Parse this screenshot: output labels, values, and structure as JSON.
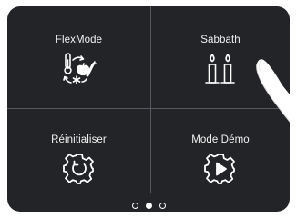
{
  "tiles": [
    {
      "label": "FlexMode",
      "icon": "flexmode-icon"
    },
    {
      "label": "Sabbath",
      "icon": "sabbath-candles-icon"
    },
    {
      "label": "Réinitialiser",
      "icon": "reset-gear-icon"
    },
    {
      "label": "Mode Démo",
      "icon": "demo-play-gear-icon"
    }
  ],
  "pager": {
    "pages": 3,
    "current": 2
  },
  "colors": {
    "panel_background": "#222427",
    "divider": "#55585c",
    "text": "#ffffff",
    "page_background": "#ffffff"
  }
}
